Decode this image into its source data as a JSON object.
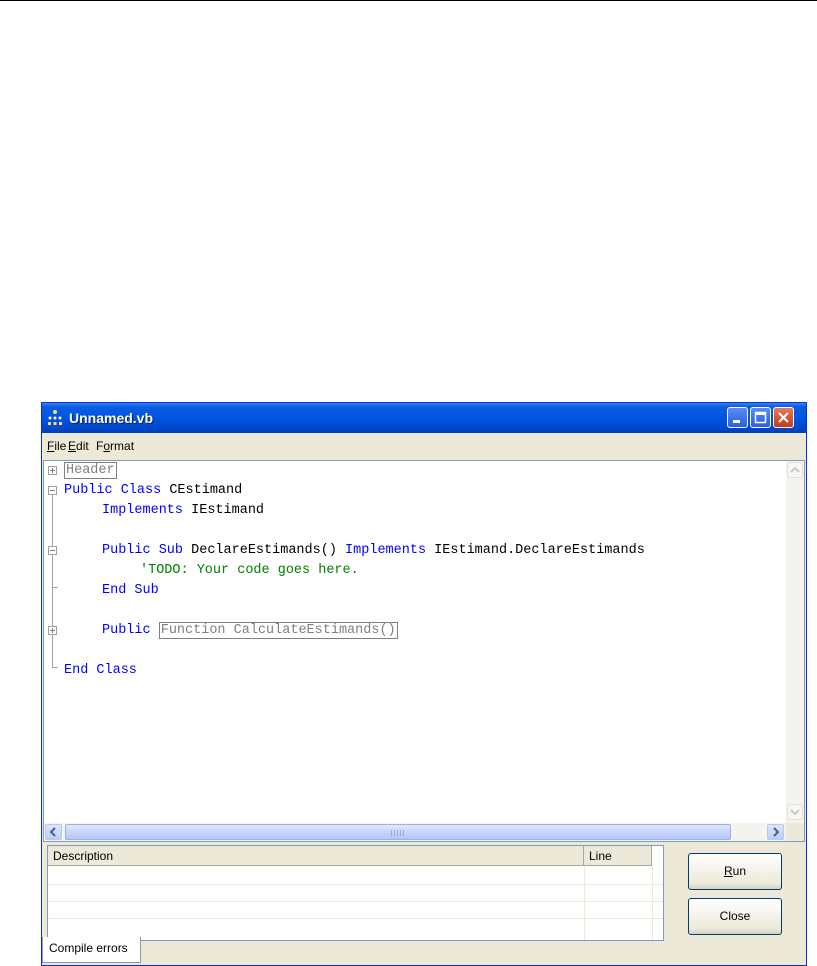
{
  "window": {
    "title": "Unnamed.vb",
    "colors": {
      "titlebar": "#0054e3",
      "keyword": "#0000ff",
      "comment": "#008000",
      "collapsed": "#808080"
    }
  },
  "menu": {
    "items": [
      {
        "mnemonic": "F",
        "rest": "ile"
      },
      {
        "mnemonic": "E",
        "rest": "dit"
      },
      {
        "pre": "F",
        "mnemonic": "o",
        "rest": "rmat"
      }
    ]
  },
  "code": {
    "line1": {
      "collapsed": "Header"
    },
    "line2": {
      "kw": "Public Class",
      "text": " CEstimand"
    },
    "line3": {
      "kw": "Implements",
      "text": " IEstimand"
    },
    "line5": {
      "kw1": "Public Sub",
      "text1": " DeclareEstimands() ",
      "kw2": "Implements",
      "text2": " IEstimand.DeclareEstimands"
    },
    "line6": {
      "comment": "'TODO: Your code goes here."
    },
    "line7": {
      "kw": "End Sub"
    },
    "line9": {
      "kw": "Public",
      "collapsed": "Function CalculateEstimands()"
    },
    "line11": {
      "kw": "End Class"
    }
  },
  "errors": {
    "columns": [
      "Description",
      "Line"
    ]
  },
  "tab": {
    "label": "Compile errors"
  },
  "buttons": {
    "run": {
      "mnemonic": "R",
      "rest": "un"
    },
    "close": {
      "label": "Close"
    }
  }
}
